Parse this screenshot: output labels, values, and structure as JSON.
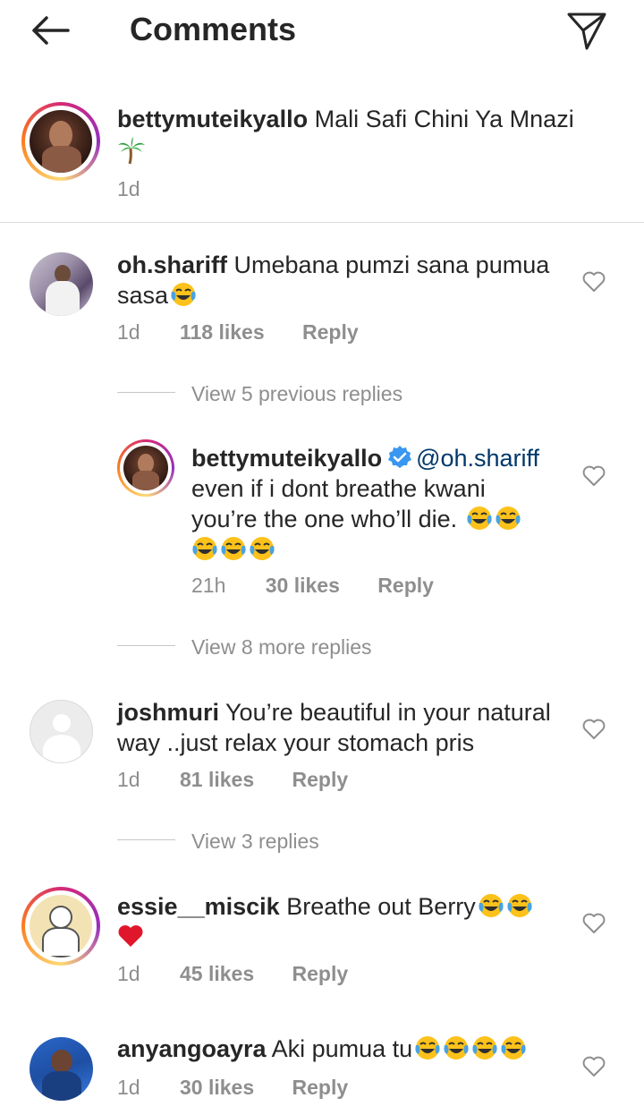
{
  "header": {
    "title": "Comments"
  },
  "caption": {
    "username": "bettymuteikyallo",
    "text": "Mali Safi Chini Ya Mnazi",
    "time": "1d"
  },
  "comments": [
    {
      "username": "oh.shariff",
      "text_line1": "Umebana pumzi sana pumua",
      "text_line2": "sasa",
      "time": "1d",
      "likes": "118 likes",
      "reply": "Reply"
    },
    {
      "username": "joshmuri",
      "text_line1": "You’re beautiful in your natural",
      "text_line2": "way ..just relax your stomach pris",
      "time": "1d",
      "likes": "81 likes",
      "reply": "Reply"
    },
    {
      "username": "essie__miscik",
      "text_line1": "Breathe out Berry",
      "time": "1d",
      "likes": "45 likes",
      "reply": "Reply"
    },
    {
      "username": "anyangoayra",
      "text_line1": "Aki pumua tu",
      "time": "1d",
      "likes": "30 likes",
      "reply": "Reply"
    }
  ],
  "replies_threads": {
    "view_previous": "View 5 previous replies",
    "view_more": "View 8 more replies",
    "view_3": "View 3 replies"
  },
  "reply": {
    "username": "bettymuteikyallo",
    "mention": "@oh.shariff",
    "text_line1": "even if i dont breathe kwani",
    "text_line2": "you’re the one who’ll die.",
    "time": "21h",
    "likes": "30 likes",
    "reply": "Reply"
  },
  "icons": {
    "back": "arrow-left-icon",
    "send": "paper-plane-icon",
    "heart": "heart-outline-icon",
    "palm": "palm-tree-emoji",
    "laugh": "tears-of-joy-emoji",
    "red_heart": "red-heart-emoji",
    "verified": "verified-badge-icon"
  },
  "colors": {
    "accent": "#00376b",
    "verified": "#3897f0",
    "muted": "#8e8e8e"
  }
}
